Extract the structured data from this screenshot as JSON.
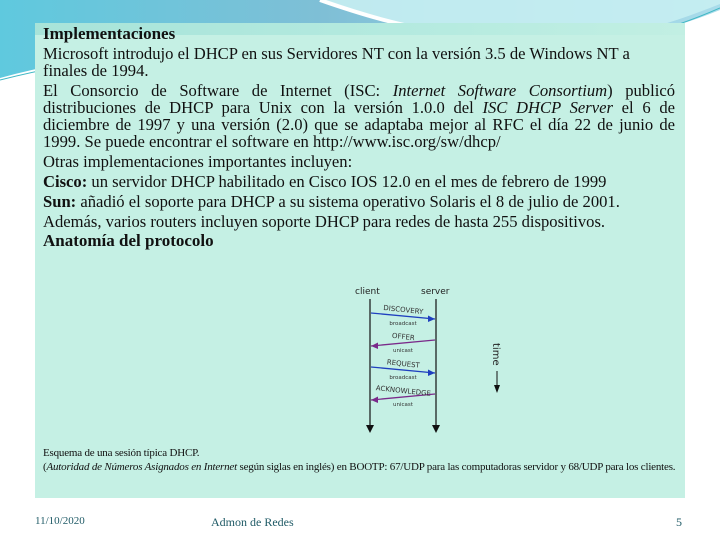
{
  "slide": {
    "heading": "Implementaciones",
    "paragraphs": {
      "p1": "Microsoft introdujo el DHCP en sus Servidores NT con la versión 3.5 de Windows NT a finales de 1994.",
      "p2_a": "El Consorcio de Software de Internet (ISC: ",
      "p2_b": "Internet Software Consortium",
      "p2_c": ") publicó distribuciones de DHCP para Unix con la versión 1.0.0 del ",
      "p2_d": "ISC DHCP Server",
      "p2_e": " el 6 de diciembre de 1997 y una versión (2.0) que se adaptaba mejor al RFC el día 22 de junio de 1999. Se puede encontrar el software en http://www.isc.org/sw/dhcp/",
      "p3": "Otras implementaciones importantes incluyen:",
      "p4_label": "Cisco:",
      "p4_text": " un servidor DHCP habilitado en Cisco IOS 12.0 en el mes de febrero de 1999",
      "p5_label": "Sun:",
      "p5_text": " añadió el soporte para DHCP a su sistema operativo Solaris el 8 de julio de 2001.",
      "p6": "Además, varios routers incluyen soporte DHCP para redes de hasta 255 dispositivos.",
      "p7": "Anatomía del protocolo"
    },
    "diagram": {
      "client_label": "client",
      "server_label": "server",
      "time_label": "time",
      "messages": [
        {
          "name": "DISCOVERY",
          "mode": "broadcast",
          "direction": "client-to-server",
          "color": "#1f3fbf"
        },
        {
          "name": "OFFER",
          "mode": "unicast",
          "direction": "server-to-client",
          "color": "#7a2a8a"
        },
        {
          "name": "REQUEST",
          "mode": "broadcast",
          "direction": "client-to-server",
          "color": "#1f3fbf"
        },
        {
          "name": "ACKNOWLEDGE",
          "mode": "unicast",
          "direction": "server-to-client",
          "color": "#7a2a8a"
        }
      ]
    },
    "caption": {
      "line1": "Esquema de una sesión típica DHCP.",
      "line2_italic": "Autoridad de Números Asignados en Internet",
      "line2_rest": " según siglas en inglés) en BOOTP: 67/UDP para las computadoras servidor y 68/UDP para los clientes.",
      "open_paren": "("
    }
  },
  "footer": {
    "date": "11/10/2020",
    "title": "Admon de Redes",
    "page": "5"
  },
  "colors": {
    "box_bg": "#c5f0e4",
    "footer_text": "#1f5a66"
  }
}
